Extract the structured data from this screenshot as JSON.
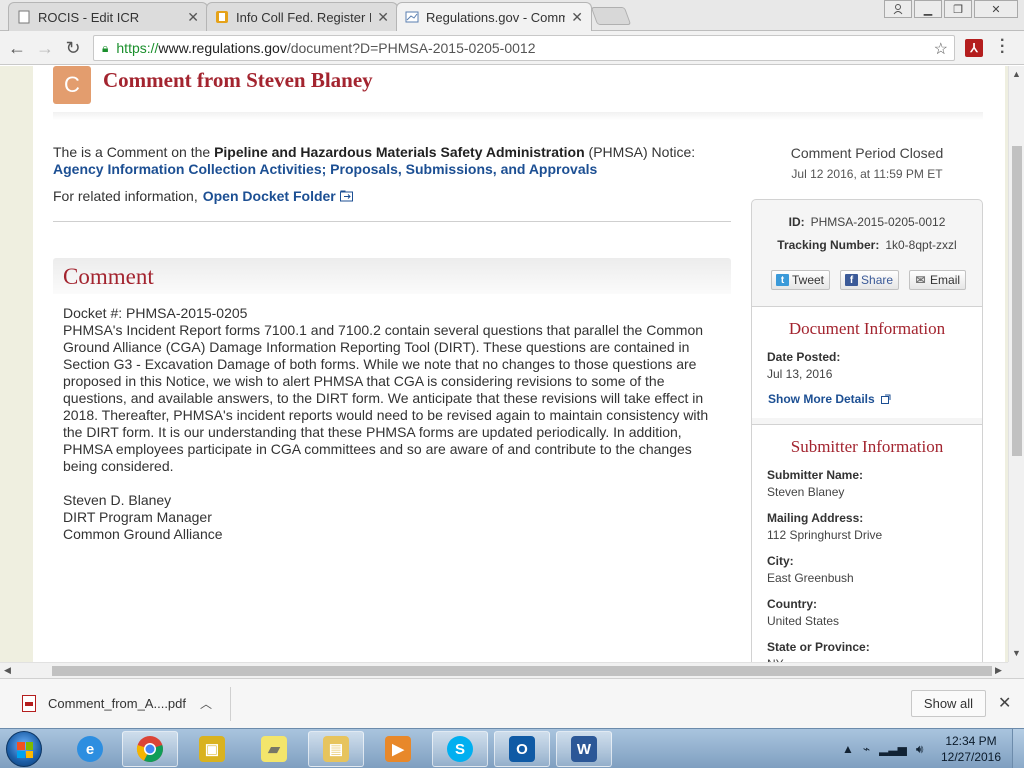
{
  "browser": {
    "tabs": [
      {
        "title": "ROCIS - Edit ICR",
        "active": false
      },
      {
        "title": "Info Coll Fed. Register No",
        "active": false
      },
      {
        "title": "Regulations.gov - Comm",
        "active": true
      }
    ],
    "url_secure": "https://",
    "url_domain": "www.regulations.gov",
    "url_path": "/document?D=PHMSA-2015-0205-0012"
  },
  "page": {
    "badge_letter": "C",
    "title": "Comment from Steven Blaney",
    "intro_prefix": "The is a Comment on the ",
    "agency_name": "Pipeline and Hazardous Materials Safety Administration",
    "agency_abbr_notice": " (PHMSA) Notice:",
    "notice_title": "Agency Information Collection Activities; Proposals, Submissions, and Approvals",
    "related_prefix": "For related information,",
    "docket_link": "Open Docket Folder",
    "comment_heading": "Comment",
    "comment_lines": [
      "Docket #: PHMSA-2015-0205",
      "PHMSA's Incident Report forms 7100.1 and 7100.2 contain several questions that parallel the Common Ground Alliance (CGA) Damage Information Reporting Tool (DIRT). These questions are contained in Section G3 - Excavation Damage of both forms. While we note that no changes to those questions are proposed in this Notice, we wish to alert PHMSA that CGA is considering revisions to some of the questions, and available answers, to the DIRT form. We anticipate that these revisions will take effect in 2018. Thereafter, PHMSA's incident reports would need to be revised again to maintain consistency with the DIRT form. It is our understanding that these PHMSA forms are updated periodically. In addition, PHMSA employees participate in CGA committees and so are aware of and contribute to the changes being considered."
    ],
    "signature": [
      "Steven D. Blaney",
      "DIRT Program Manager",
      "Common Ground Alliance"
    ]
  },
  "sidebar": {
    "period_status": "Comment Period Closed",
    "period_date": "Jul 12 2016, at 11:59 PM ET",
    "id_label": "ID:",
    "id_value": "PHMSA-2015-0205-0012",
    "tracking_label": "Tracking Number:",
    "tracking_value": "1k0-8qpt-zxzl",
    "share": {
      "tweet": "Tweet",
      "share": "Share",
      "email": "Email"
    },
    "doc_info": {
      "heading": "Document Information",
      "date_posted_label": "Date Posted:",
      "date_posted_value": "Jul 13, 2016",
      "more_link": "Show More Details"
    },
    "submitter": {
      "heading": "Submitter Information",
      "fields": [
        {
          "label": "Submitter Name:",
          "value": "Steven Blaney"
        },
        {
          "label": "Mailing Address:",
          "value": "112 Springhurst Drive"
        },
        {
          "label": "City:",
          "value": "East Greenbush"
        },
        {
          "label": "Country:",
          "value": "United States"
        },
        {
          "label": "State or Province:",
          "value": "NY"
        }
      ]
    }
  },
  "downloads": {
    "file_name": "Comment_from_A....pdf",
    "show_all": "Show all"
  },
  "taskbar": {
    "time": "12:34 PM",
    "date": "12/27/2016"
  },
  "colors": {
    "accent_red": "#a3242f",
    "link_blue": "#1c4f93",
    "badge_orange": "#e39d6e"
  }
}
